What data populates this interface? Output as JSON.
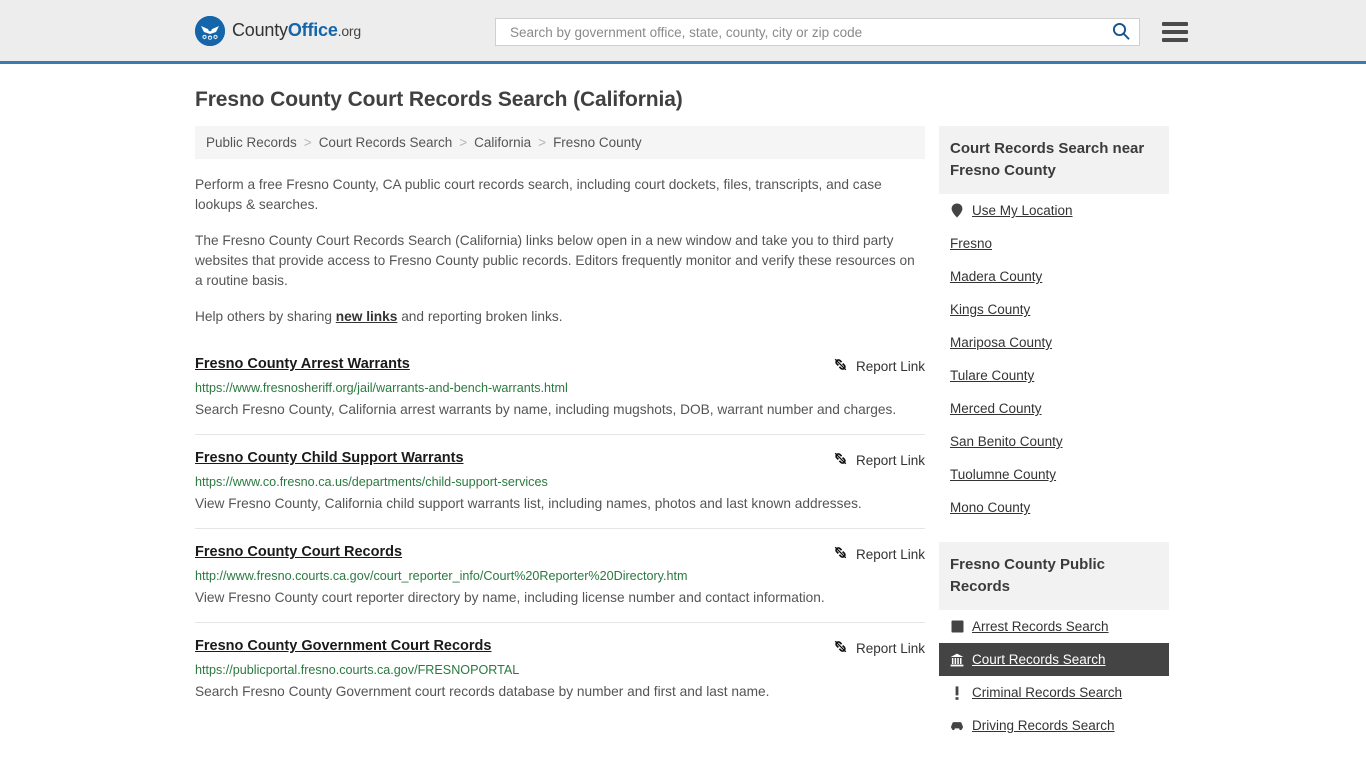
{
  "header": {
    "logo": {
      "text_county": "County",
      "text_office": "Office",
      "text_org": ".org",
      "icon": "eagle-shield-logo"
    },
    "search": {
      "placeholder": "Search by government office, state, county, city or zip code",
      "value": "",
      "icon": "search-icon"
    },
    "menu_icon": "hamburger-menu-icon"
  },
  "page": {
    "title": "Fresno County Court Records Search (California)"
  },
  "breadcrumb": {
    "items": [
      {
        "label": "Public Records",
        "current": false
      },
      {
        "label": "Court Records Search",
        "current": false
      },
      {
        "label": "California",
        "current": false
      },
      {
        "label": "Fresno County",
        "current": true
      }
    ],
    "separator": ">"
  },
  "intro": {
    "paragraph_1": "Perform a free Fresno County, CA public court records search, including court dockets, files, transcripts, and case lookups & searches.",
    "paragraph_2": "The Fresno County Court Records Search (California) links below open in a new window and take you to third party websites that provide access to Fresno County public records. Editors frequently monitor and verify these resources on a routine basis.",
    "paragraph_3_pre": "Help others by sharing ",
    "paragraph_3_link": "new links",
    "paragraph_3_post": " and reporting broken links."
  },
  "results": {
    "report_link_label": "Report Link",
    "report_link_icon": "broken-link-icon",
    "items": [
      {
        "title": "Fresno County Arrest Warrants",
        "url": "https://www.fresnosheriff.org/jail/warrants-and-bench-warrants.html",
        "description": "Search Fresno County, California arrest warrants by name, including mugshots, DOB, warrant number and charges."
      },
      {
        "title": "Fresno County Child Support Warrants",
        "url": "https://www.co.fresno.ca.us/departments/child-support-services",
        "description": "View Fresno County, California child support warrants list, including names, photos and last known addresses."
      },
      {
        "title": "Fresno County Court Records",
        "url": "http://www.fresno.courts.ca.gov/court_reporter_info/Court%20Reporter%20Directory.htm",
        "description": "View Fresno County court reporter directory by name, including license number and contact information."
      },
      {
        "title": "Fresno County Government Court Records",
        "url": "https://publicportal.fresno.courts.ca.gov/FRESNOPORTAL",
        "description": "Search Fresno County Government court records database by number and first and last name."
      }
    ]
  },
  "sidebar": {
    "nearby": {
      "heading": "Court Records Search near Fresno County",
      "items": [
        {
          "label": "Use My Location",
          "icon": "location-pin-icon",
          "active": false
        },
        {
          "label": "Fresno",
          "icon": "",
          "active": false
        },
        {
          "label": "Madera County",
          "icon": "",
          "active": false
        },
        {
          "label": "Kings County",
          "icon": "",
          "active": false
        },
        {
          "label": "Mariposa County",
          "icon": "",
          "active": false
        },
        {
          "label": "Tulare County",
          "icon": "",
          "active": false
        },
        {
          "label": "Merced County",
          "icon": "",
          "active": false
        },
        {
          "label": "San Benito County",
          "icon": "",
          "active": false
        },
        {
          "label": "Tuolumne County",
          "icon": "",
          "active": false
        },
        {
          "label": "Mono County",
          "icon": "",
          "active": false
        }
      ]
    },
    "public_records": {
      "heading": "Fresno County Public Records",
      "items": [
        {
          "label": "Arrest Records Search",
          "icon": "fingerprint-square-icon",
          "active": false
        },
        {
          "label": "Court Records Search",
          "icon": "courthouse-icon",
          "active": true
        },
        {
          "label": "Criminal Records Search",
          "icon": "exclamation-icon",
          "active": false
        },
        {
          "label": "Driving Records Search",
          "icon": "car-icon",
          "active": false
        }
      ]
    }
  },
  "colors": {
    "header_bg": "#ededed",
    "header_border": "#3a7ab0",
    "brand_blue": "#1565ab",
    "url_green": "#2a7a3f",
    "active_bg": "#444444",
    "panel_bg": "#f2f2f2"
  }
}
